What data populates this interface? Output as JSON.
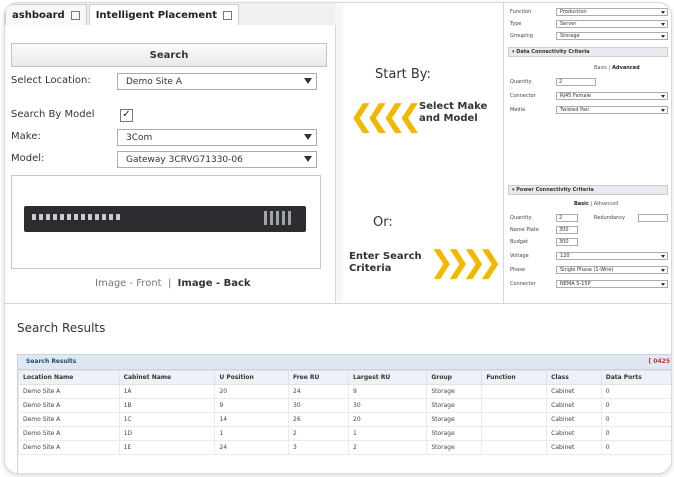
{
  "tabs": [
    {
      "label": "ashboard"
    },
    {
      "label": "Intelligent Placement"
    }
  ],
  "search": {
    "button_label": "Search",
    "location_label": "Select Location:",
    "location_value": "Demo Site A",
    "model_label": "Search By Model",
    "model_checked": "✓",
    "make_label": "Make:",
    "make_value": "3Com",
    "modelname_label": "Model:",
    "modelname_value": "Gateway 3CRVG71330-06",
    "image_front": "Image - Front",
    "image_separator": "|",
    "image_back": "Image - Back"
  },
  "middle": {
    "start_by": "Start By:",
    "select_make_1": "Select Make",
    "select_make_2": "and Model",
    "or": "Or:",
    "enter_1": "Enter Search",
    "enter_2": "Criteria",
    "chevrons_left": "❮❮❮❮",
    "chevrons_right": "❯❯❯❯"
  },
  "criteria": {
    "function_label": "Function",
    "function_value": "Production",
    "type_label": "Type",
    "type_value": "Server",
    "grouping_label": "Grouping",
    "grouping_value": "Storage",
    "data_header": "▾ Data Connectivity Criteria",
    "basic": "Basic",
    "advanced": "Advanced",
    "quantity_label": "Quantity",
    "quantity_value": "2",
    "connector_label": "Connector",
    "connector_value": "RJ45 Female",
    "media_label": "Media",
    "media_value": "Twisted Pair",
    "power_header": "▾ Power Connectivity Criteria",
    "p_quantity_label": "Quantity",
    "p_quantity_value": "2",
    "redundancy_label": "Redundancy",
    "nameplate_label": "Name Plate",
    "nameplate_value": "300",
    "budget_label": "Budget",
    "budget_value": "300",
    "voltage_label": "Voltage",
    "voltage_value": "120",
    "phase_label": "Phase",
    "phase_value": "Single Phase (1-Wire)",
    "p_connector_label": "Connector",
    "p_connector_value": "NEMA 5-15P"
  },
  "results": {
    "title": "Search Results",
    "bar_title": "Search Results",
    "count": "[ 0425",
    "columns": [
      "Location Name",
      "Cabinet Name",
      "U Position",
      "Free RU",
      "Largest RU",
      "Group",
      "Function",
      "Class",
      "Data Ports"
    ],
    "rows": [
      [
        "Demo Site A",
        "1A",
        "20",
        "24",
        "9",
        "Storage",
        "",
        "Cabinet",
        "0"
      ],
      [
        "Demo Site A",
        "1B",
        "9",
        "30",
        "30",
        "Storage",
        "",
        "Cabinet",
        "0"
      ],
      [
        "Demo Site A",
        "1C",
        "14",
        "26",
        "20",
        "Storage",
        "",
        "Cabinet",
        "0"
      ],
      [
        "Demo Site A",
        "1D",
        "1",
        "2",
        "1",
        "Storage",
        "",
        "Cabinet",
        "0"
      ],
      [
        "Demo Site A",
        "1E",
        "24",
        "3",
        "2",
        "Storage",
        "",
        "Cabinet",
        "0"
      ]
    ]
  }
}
